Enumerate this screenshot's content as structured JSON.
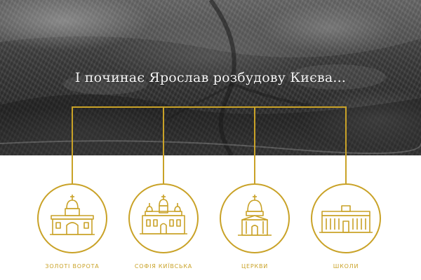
{
  "hero": {
    "title": "І починає Ярослав розбудову Києва..."
  },
  "colors": {
    "accent": "#c9a227",
    "hero_text": "#f4f4f4",
    "background": "#ffffff"
  },
  "items": [
    {
      "label": "Золоті ворота",
      "icon": "golden-gate-icon"
    },
    {
      "label": "Софія Київська",
      "icon": "sophia-cathedral-icon"
    },
    {
      "label": "Церкви",
      "icon": "church-icon"
    },
    {
      "label": "Школи",
      "icon": "school-icon"
    }
  ]
}
